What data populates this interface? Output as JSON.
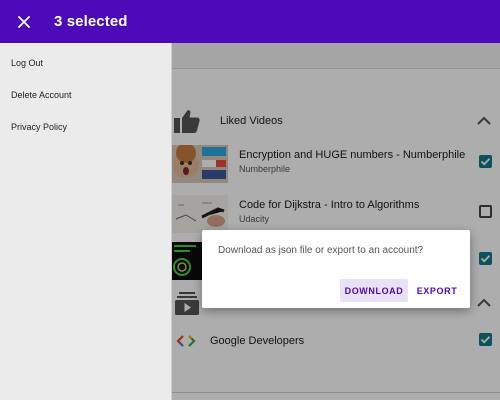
{
  "appbar": {
    "title": "3 selected",
    "close_icon": "close-icon",
    "color": "#4c0ab8"
  },
  "drawer": {
    "items": [
      {
        "label": "Log Out"
      },
      {
        "label": "Delete Account"
      },
      {
        "label": "Privacy Policy"
      }
    ]
  },
  "sections": [
    {
      "label": "Liked Videos",
      "icon": "thumb-up-icon",
      "items": [
        {
          "title": "Encryption and HUGE numbers - Numberphile",
          "subtitle": "Numberphile",
          "checked": true
        },
        {
          "title": "Code for Dijkstra - Intro to Algorithms",
          "subtitle": "Udacity",
          "checked": false
        },
        {
          "title": "",
          "subtitle": "",
          "checked": true
        }
      ]
    },
    {
      "label": "",
      "icon": "subscriptions-icon",
      "items": [
        {
          "title": "Google Developers",
          "subtitle": "",
          "checked": true
        }
      ]
    }
  ],
  "dialog": {
    "message": "Download as json file or export to an account?",
    "download_label": "DOWNLOAD",
    "export_label": "EXPORT"
  },
  "colors": {
    "primary": "#4c0ab8",
    "checkbox": "#127a8a"
  }
}
